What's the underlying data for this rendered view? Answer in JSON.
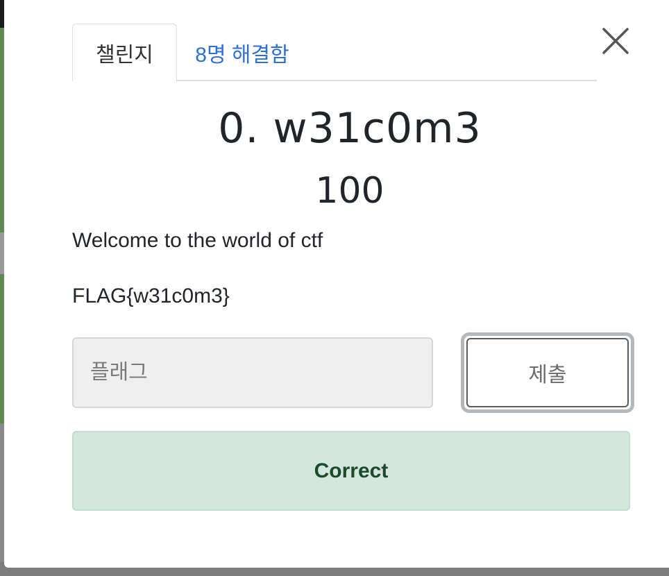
{
  "modal": {
    "tabs": [
      {
        "label": "챌린지",
        "active": true
      },
      {
        "label": "8명 해결함",
        "active": false
      }
    ],
    "close_icon": "close-icon",
    "challenge": {
      "title": "0. w31c0m3",
      "points": "100",
      "description": "Welcome to the world of ctf",
      "flag_hint": "FLAG{w31c0m3}"
    },
    "submission": {
      "input_placeholder": "플래그",
      "input_value": "",
      "submit_label": "제출",
      "result": "Correct"
    }
  },
  "colors": {
    "tab_link": "#2f6fd9",
    "correct_bg": "#d4e7de",
    "correct_text": "#1d4a2b",
    "input_bg": "#efefef"
  }
}
